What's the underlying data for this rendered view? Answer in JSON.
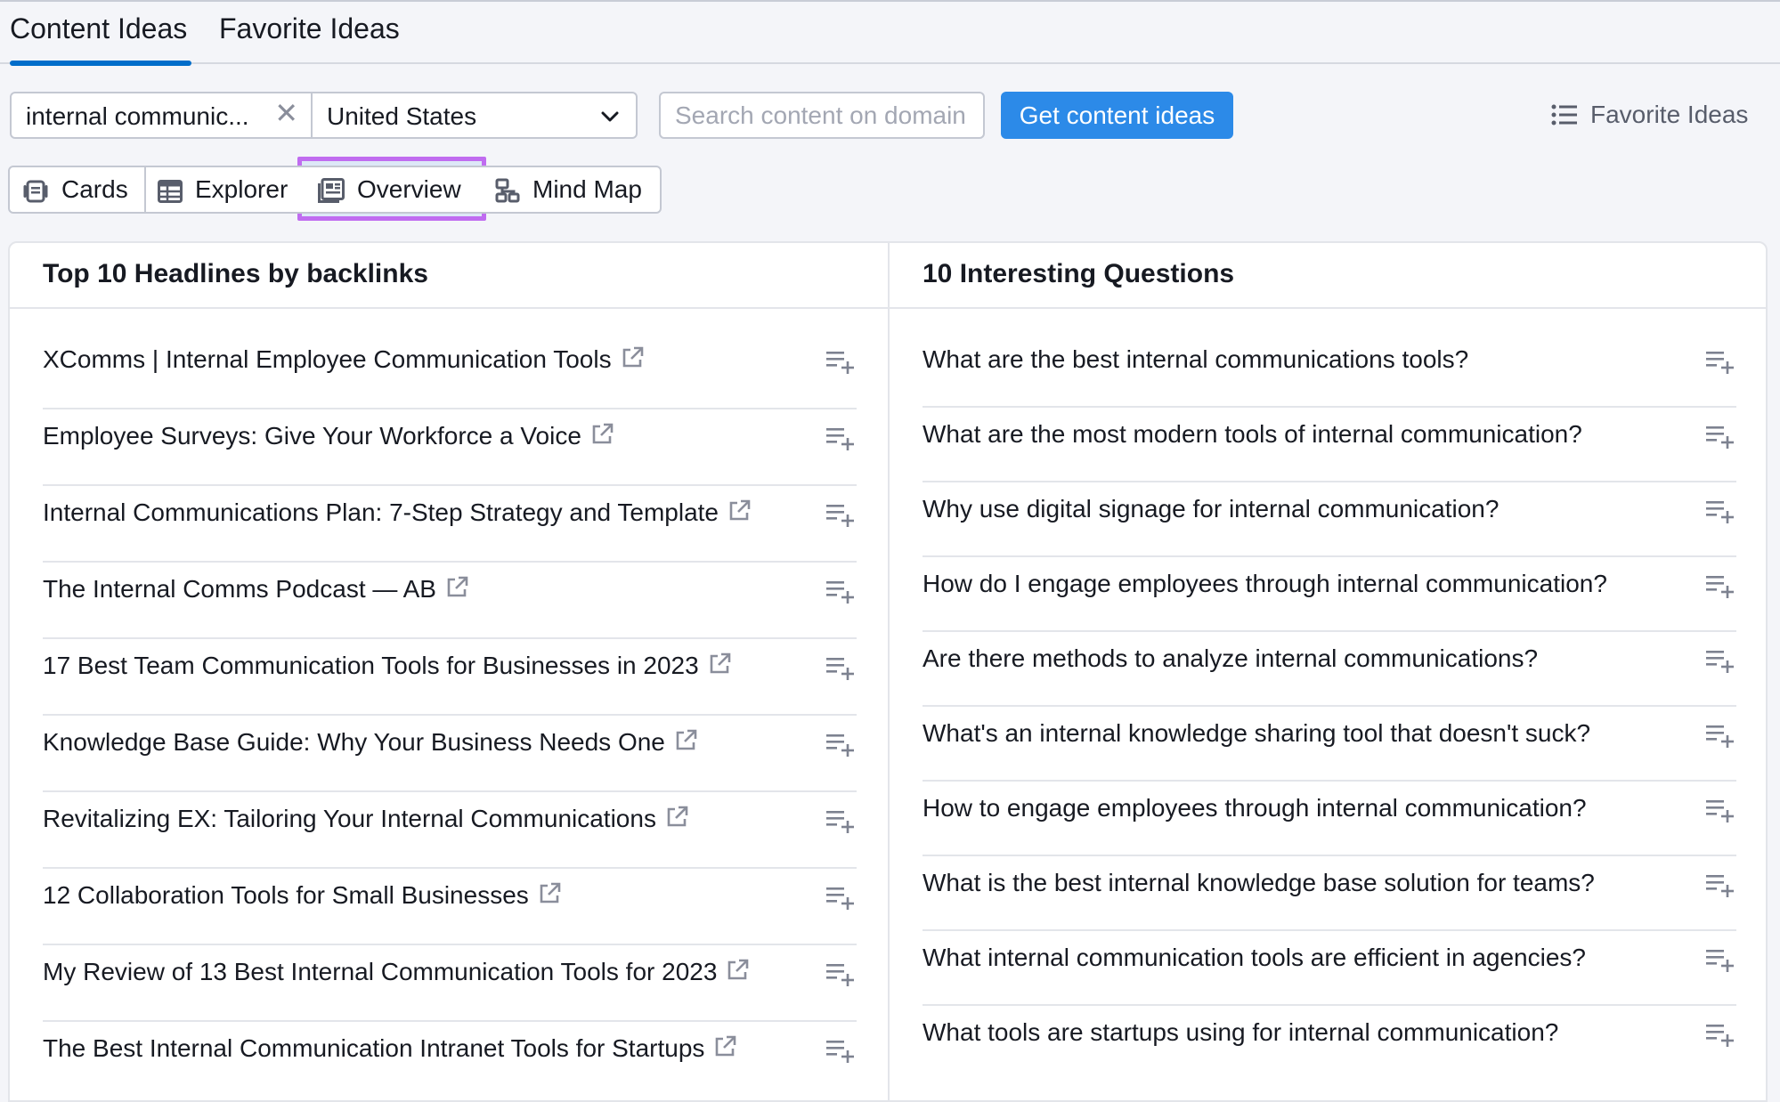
{
  "tabs": [
    {
      "label": "Content Ideas",
      "active": true
    },
    {
      "label": "Favorite Ideas",
      "active": false
    }
  ],
  "search": {
    "keyword_value": "internal communic...",
    "country_value": "United States",
    "domain_placeholder": "Search content on domain",
    "get_button_label": "Get content ideas",
    "favorite_link_label": "Favorite Ideas"
  },
  "views": {
    "cards": "Cards",
    "explorer": "Explorer",
    "overview": "Overview",
    "mind_map": "Mind Map",
    "active": "Overview"
  },
  "headlines": {
    "title": "Top 10 Headlines by backlinks",
    "items": [
      "XComms | Internal Employee Communication Tools",
      "Employee Surveys: Give Your Workforce a Voice",
      "Internal Communications Plan: 7-Step Strategy and Template",
      "The Internal Comms Podcast — AB",
      "17 Best Team Communication Tools for Businesses in 2023",
      "Knowledge Base Guide: Why Your Business Needs One",
      "Revitalizing EX: Tailoring Your Internal Communications",
      "12 Collaboration Tools for Small Businesses",
      "My Review of 13 Best Internal Communication Tools for 2023",
      "The Best Internal Communication Intranet Tools for Startups"
    ]
  },
  "questions": {
    "title": "10 Interesting Questions",
    "items": [
      "What are the best internal communications tools?",
      "What are the most modern tools of internal communication?",
      "Why use digital signage for internal communication?",
      "How do I engage employees through internal communication?",
      "Are there methods to analyze internal communications?",
      "What's an internal knowledge sharing tool that doesn't suck?",
      "How to engage employees through internal communication?",
      "What is the best internal knowledge base solution for teams?",
      "What internal communication tools are efficient in agencies?",
      "What tools are startups using for internal communication?"
    ]
  },
  "colors": {
    "accent_blue": "#2c8ae8",
    "tab_underline": "#006dca",
    "highlight_border": "#c06cf0"
  }
}
